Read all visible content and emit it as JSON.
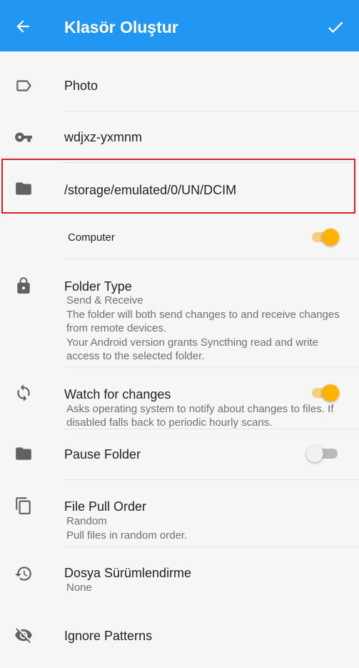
{
  "appbar": {
    "title": "Klasör Oluştur",
    "back_icon": "arrow-back-icon",
    "confirm_icon": "check-icon",
    "color": "#2196f3"
  },
  "fields": {
    "label": {
      "value": "Photo",
      "icon": "label-icon"
    },
    "id": {
      "value": "wdjxz-yxmnm",
      "icon": "key-icon"
    },
    "path": {
      "value": "/storage/emulated/0/UN/DCIM",
      "icon": "folder-icon"
    }
  },
  "device": {
    "name": "Computer",
    "enabled": true
  },
  "folder_type": {
    "title": "Folder Type",
    "value": "Send & Receive",
    "desc_1": "The folder will both send changes to and receive changes",
    "desc_2": "from remote devices.",
    "desc_3": "Your Android version grants Syncthing read and write",
    "desc_4": "access to the selected folder."
  },
  "watch": {
    "title": "Watch for changes",
    "desc_1": "Asks operating system to notify about changes to files. If",
    "desc_2": "disabled falls back to periodic hourly scans.",
    "enabled": true
  },
  "pause": {
    "title": "Pause Folder",
    "enabled": false
  },
  "pull_order": {
    "title": "File Pull Order",
    "value": "Random",
    "desc": "Pull files in random order."
  },
  "versioning": {
    "title": "Dosya Sürümlendirme",
    "value": "None"
  },
  "ignore": {
    "title": "Ignore Patterns"
  },
  "colors": {
    "accent": "#ffb300",
    "highlight_border": "#d8232a",
    "icon": "#616161"
  }
}
